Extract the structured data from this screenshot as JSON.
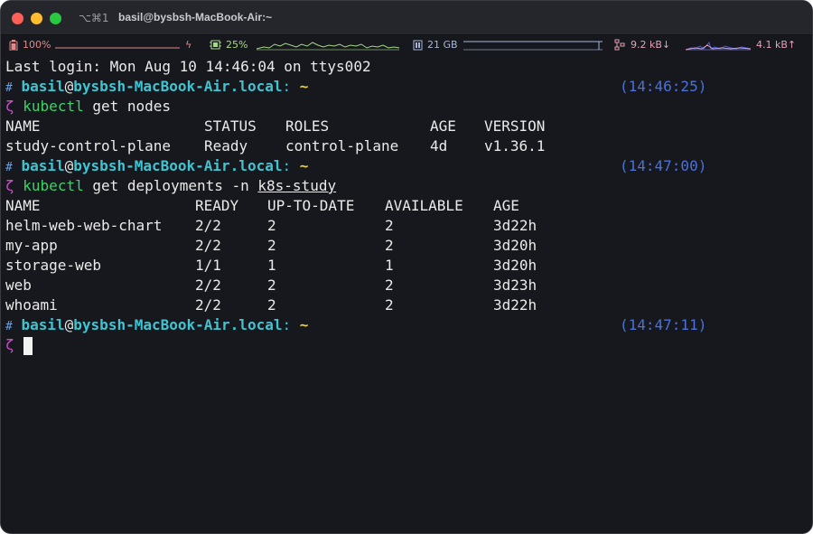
{
  "window": {
    "shortcut": "⌥⌘1",
    "title": "basil@bysbsh-MacBook-Air:~"
  },
  "statusbar": {
    "battery": "100%",
    "battery_icon": "battery-icon",
    "charging_icon": "bolt-icon",
    "cpu": "25%",
    "cpu_icon": "cpu-chip-icon",
    "memory": "21 GB",
    "memory_icon": "memory-icon",
    "network_icon": "network-icon",
    "net_down": "9.2 kB↓",
    "net_up": "4.1 kB↑",
    "colors": {
      "battery": "#e08a8a",
      "cpu": "#a8d98a",
      "memory": "#a7b8d8",
      "network": "#e5a0b8"
    }
  },
  "terminal": {
    "last_login": "Last login: Mon Aug 10 14:46:04 on ttys002",
    "prompt": {
      "hash": "#",
      "user": "basil",
      "at": "@",
      "host": "bysbsh-MacBook-Air.local",
      "colon": ":",
      "path": "~",
      "symbol": "ζ"
    },
    "blocks": [
      {
        "time": "(14:46:25)",
        "cmd_name": "kubectl",
        "cmd_args": "get nodes",
        "cmd_arg_underlined": "",
        "headers": [
          "NAME",
          "STATUS",
          "ROLES",
          "AGE",
          "VERSION"
        ],
        "rows": [
          [
            "study-control-plane",
            "Ready",
            "control-plane",
            "4d",
            "v1.36.1"
          ]
        ]
      },
      {
        "time": "(14:47:00)",
        "cmd_name": "kubectl",
        "cmd_args": "get deployments -n",
        "cmd_arg_underlined": "k8s-study",
        "headers": [
          "NAME",
          "READY",
          "UP-TO-DATE",
          "AVAILABLE",
          "AGE"
        ],
        "rows": [
          [
            "helm-web-web-chart",
            "2/2",
            "2",
            "2",
            "3d22h"
          ],
          [
            "my-app",
            "2/2",
            "2",
            "2",
            "3d20h"
          ],
          [
            "storage-web",
            "1/1",
            "1",
            "1",
            "3d20h"
          ],
          [
            "web",
            "2/2",
            "2",
            "2",
            "3d23h"
          ],
          [
            "whoami",
            "2/2",
            "2",
            "2",
            "3d22h"
          ]
        ]
      },
      {
        "time": "(14:47:11)"
      }
    ]
  }
}
